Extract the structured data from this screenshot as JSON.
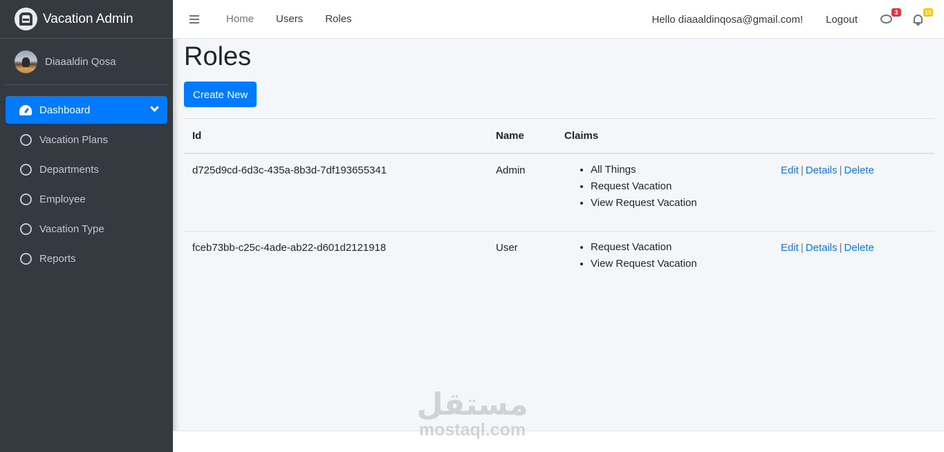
{
  "brand": {
    "title": "Vacation Admin"
  },
  "user": {
    "name": "Diaaaldin Qosa"
  },
  "sidebar": {
    "items": [
      {
        "label": "Dashboard",
        "icon": "dashboard-gauge-icon",
        "active": true
      },
      {
        "label": "Vacation Plans",
        "icon": "circle-icon"
      },
      {
        "label": "Departments",
        "icon": "circle-icon"
      },
      {
        "label": "Employee",
        "icon": "circle-icon"
      },
      {
        "label": "Vacation Type",
        "icon": "circle-icon"
      },
      {
        "label": "Reports",
        "icon": "circle-icon"
      }
    ]
  },
  "topbar": {
    "links": [
      "Home",
      "Users",
      "Roles"
    ],
    "greeting": "Hello diaaaldinqosa@gmail.com!",
    "logout": "Logout",
    "messages_count": "3",
    "notifications_count": "15"
  },
  "page": {
    "title": "Roles",
    "create_label": "Create New"
  },
  "table": {
    "headers": [
      "Id",
      "Name",
      "Claims",
      ""
    ],
    "rows": [
      {
        "id": "d725d9cd-6d3c-435a-8b3d-7df193655341",
        "name": "Admin",
        "claims": [
          "All Things",
          "Request Vacation",
          "View Request Vacation"
        ],
        "actions": [
          "Edit",
          "Details",
          "Delete"
        ]
      },
      {
        "id": "fceb73bb-c25c-4ade-ab22-d601d2121918",
        "name": "User",
        "claims": [
          "Request Vacation",
          "View Request Vacation"
        ],
        "actions": [
          "Edit",
          "Details",
          "Delete"
        ]
      }
    ],
    "separator": "|"
  },
  "watermark": {
    "arabic": "مستقل",
    "latin": "mostaql.com"
  },
  "colors": {
    "primary": "#007bff",
    "sidebar": "#343a40",
    "background": "#f4f6f9"
  }
}
